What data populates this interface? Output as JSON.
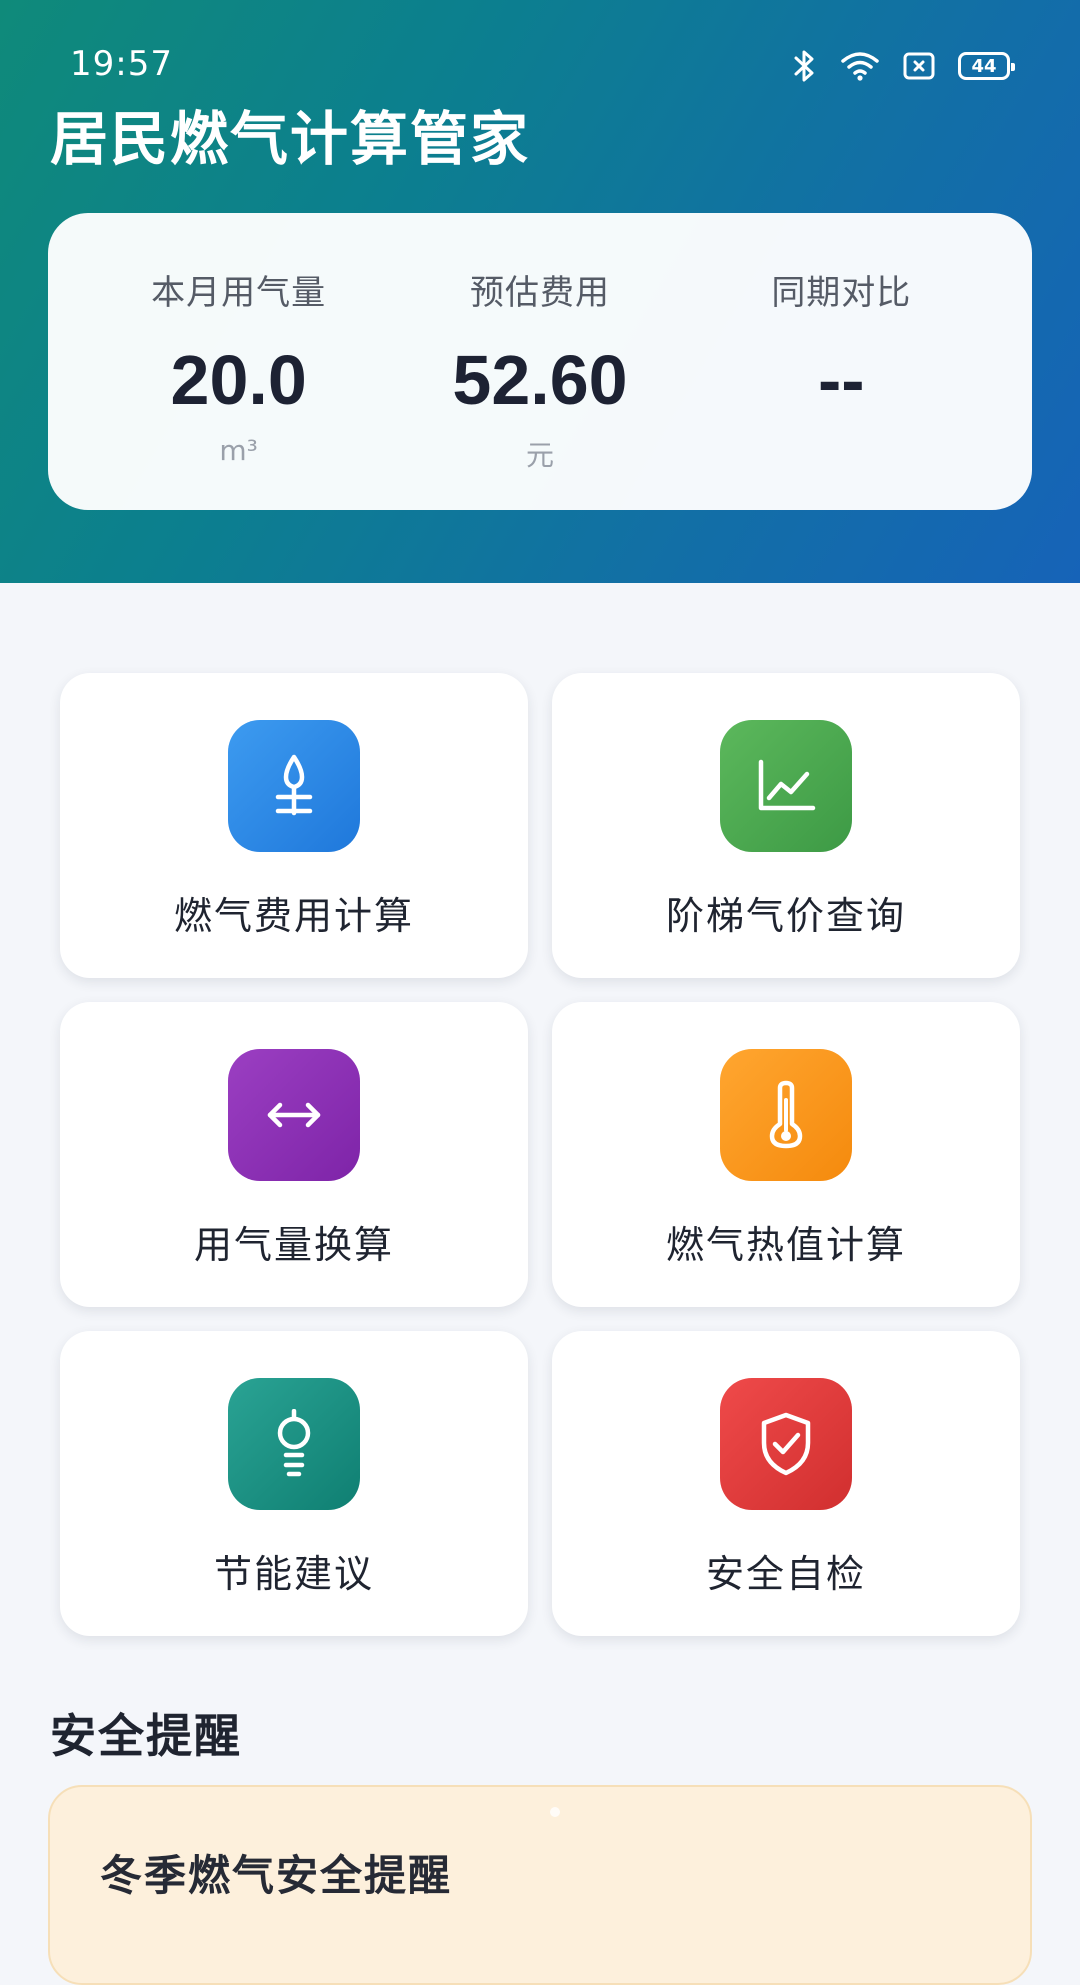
{
  "status_bar": {
    "time": "19:57",
    "battery": "44"
  },
  "app": {
    "title": "居民燃气计算管家"
  },
  "stats": [
    {
      "label": "本月用气量",
      "value": "20.0",
      "unit": "m³"
    },
    {
      "label": "预估费用",
      "value": "52.60",
      "unit": "元"
    },
    {
      "label": "同期对比",
      "value": "--",
      "unit": ""
    }
  ],
  "tools": [
    {
      "label": "燃气费用计算",
      "icon": "flame-icon",
      "color_start": "#3d9bf0",
      "color_end": "#1f78db"
    },
    {
      "label": "阶梯气价查询",
      "icon": "line-chart-icon",
      "color_start": "#5cb85c",
      "color_end": "#3d9a45"
    },
    {
      "label": "用气量换算",
      "icon": "swap-horizontal-icon",
      "color_start": "#9b3fc2",
      "color_end": "#7e24a8"
    },
    {
      "label": "燃气热值计算",
      "icon": "thermometer-icon",
      "color_start": "#ffa630",
      "color_end": "#f58a0d"
    },
    {
      "label": "节能建议",
      "icon": "lightbulb-icon",
      "color_start": "#2aa394",
      "color_end": "#0f7f72"
    },
    {
      "label": "安全自检",
      "icon": "shield-check-icon",
      "color_start": "#ef4a4a",
      "color_end": "#d12f2f"
    }
  ],
  "safety": {
    "section_title": "安全提醒",
    "card_title": "冬季燃气安全提醒"
  }
}
